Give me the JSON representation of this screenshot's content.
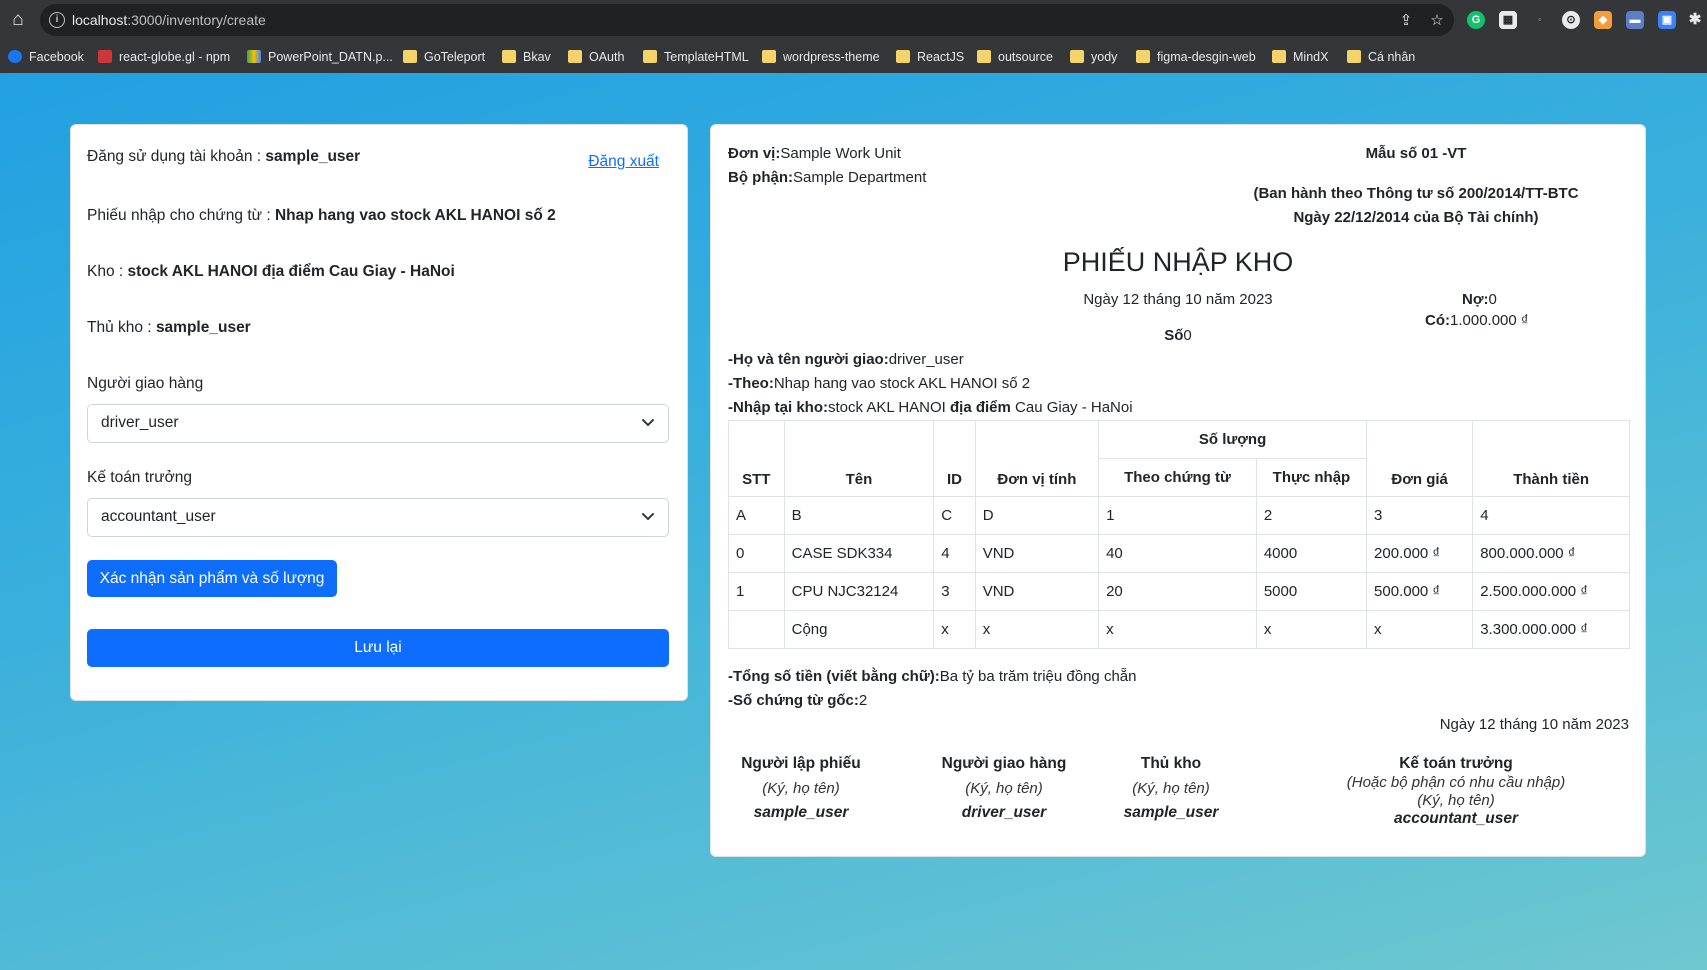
{
  "browser": {
    "url_host": "localhost",
    "url_rest": ":3000/inventory/create",
    "bookmarks": [
      "Facebook",
      "react-globe.gl - npm",
      "PowerPoint_DATN.p...",
      "GoTeleport",
      "Bkav",
      "OAuth",
      "TemplateHTML",
      "wordpress-theme",
      "ReactJS",
      "outsource",
      "yody",
      "figma-desgin-web",
      "MindX",
      "Cá nhân"
    ]
  },
  "left": {
    "account_label": "Đăng sử dụng tài khoản : ",
    "account_user": "sample_user",
    "logout": "Đăng xuất",
    "voucher_label": "Phiếu nhập cho chứng từ : ",
    "voucher_value": "Nhap hang vao stock AKL HANOI số 2",
    "warehouse_label": "Kho : ",
    "warehouse_value": "stock AKL HANOI địa điểm Cau Giay - HaNoi",
    "keeper_label": "Thủ kho : ",
    "keeper_value": "sample_user",
    "deliverer_label": "Người giao hàng",
    "deliverer_value": "driver_user",
    "accountant_label": "Kế toán trưởng",
    "accountant_value": "accountant_user",
    "confirm_button": "Xác nhận sản phẩm và số lượng",
    "save_button": "Lưu lại"
  },
  "doc": {
    "unit_label": "Đơn vị:",
    "unit_value": "Sample Work Unit",
    "dept_label": "Bộ phận:",
    "dept_value": "Sample Department",
    "form_no": "Mẫu số 01 -VT",
    "issued_1": "(Ban hành theo Thông tư số 200/2014/TT-BTC",
    "issued_2": "Ngày 22/12/2014 của Bộ Tài chính)",
    "title": "PHIẾU NHẬP KHO",
    "date": "Ngày 12 tháng 10 năm 2023",
    "no_label": "Số",
    "no_value": "0",
    "debit_label": "Nợ:",
    "debit_value": "0",
    "credit_label": "Có:",
    "credit_value": "1.000.000 ₫",
    "deliverer_label": "-Họ và tên người giao:",
    "deliverer_value": "driver_user",
    "according_label": "-Theo:",
    "according_value": "Nhap hang vao stock AKL HANOI số 2",
    "import_label": "-Nhập tại kho:",
    "import_value_1": "stock AKL HANOI ",
    "import_value_bold": "địa điểm",
    "import_value_2": " Cau Giay - HaNoi",
    "total_words_label": "-Tổng số tiền (viết bằng chữ):",
    "total_words_value": "Ba tỷ ba trăm triệu đồng chẵn",
    "orig_docs_label": "-Số chứng từ gốc:",
    "orig_docs_value": "2",
    "sign_date": "Ngày 12 tháng 10 năm 2023"
  },
  "table": {
    "headers": {
      "stt": "STT",
      "name": "Tên",
      "id": "ID",
      "unit": "Đơn vị tính",
      "qty": "Số lượng",
      "qty_doc": "Theo chứng từ",
      "qty_real": "Thực nhập",
      "price": "Đơn giá",
      "amount": "Thành tiền"
    },
    "rows": [
      [
        "A",
        "B",
        "C",
        "D",
        "1",
        "2",
        "3",
        "4"
      ],
      [
        "0",
        "CASE SDK334",
        "4",
        "VND",
        "40",
        "4000",
        "200.000 ₫",
        "800.000.000 ₫"
      ],
      [
        "1",
        "CPU NJC32124",
        "3",
        "VND",
        "20",
        "5000",
        "500.000 ₫",
        "2.500.000.000 ₫"
      ],
      [
        "",
        "Cộng",
        "x",
        "x",
        "x",
        "x",
        "x",
        "3.300.000.000 ₫"
      ]
    ]
  },
  "signatures": {
    "creator_title": "Người lập phiếu",
    "creator_hint": "(Ký, họ tên)",
    "creator_name": "sample_user",
    "deliverer_title": "Người giao hàng",
    "deliverer_hint": "(Ký, họ tên)",
    "deliverer_name": "driver_user",
    "keeper_title": "Thủ kho",
    "keeper_hint": "(Ký, họ tên)",
    "keeper_name": "sample_user",
    "accountant_title": "Kế toán trưởng",
    "accountant_hint_1": "(Hoặc bộ phận có nhu cầu nhập)",
    "accountant_hint_2": "(Ký, họ tên)",
    "accountant_name": "accountant_user"
  }
}
